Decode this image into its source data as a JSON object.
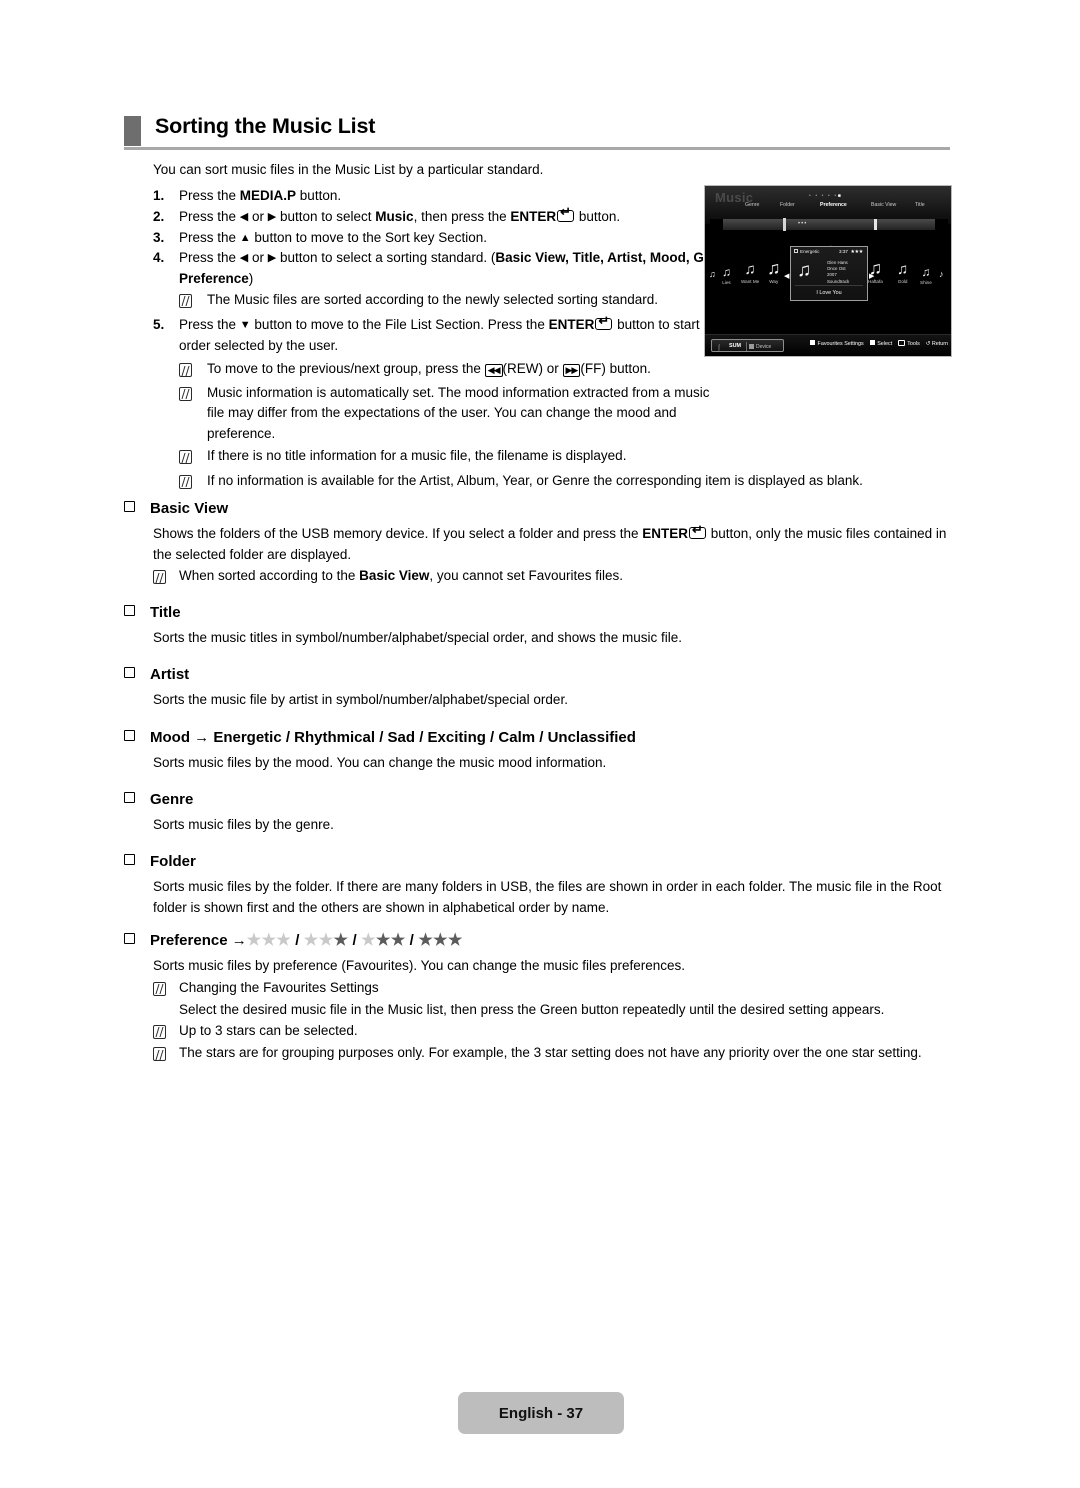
{
  "header": {
    "title": "Sorting the Music List"
  },
  "intro": "You can sort music files in the Music List by a particular standard.",
  "steps": [
    {
      "num": "1.",
      "parts": [
        {
          "t": "Press the ",
          "b": false
        },
        {
          "t": "MEDIA.P",
          "b": true
        },
        {
          "t": " button.",
          "b": false
        }
      ]
    },
    {
      "num": "2.",
      "parts": [
        {
          "t": "Press the ",
          "b": false
        },
        {
          "t": "◀",
          "b": false
        },
        {
          "t": " or ",
          "b": false
        },
        {
          "t": "▶",
          "b": false
        },
        {
          "t": " button to select ",
          "b": false
        },
        {
          "t": "Music",
          "b": true
        },
        {
          "t": ", then press the ",
          "b": false
        },
        {
          "t": "ENTER",
          "b": true
        },
        {
          "t": "ENTER_ICON",
          "b": false
        },
        {
          "t": " button.",
          "b": false
        }
      ]
    },
    {
      "num": "3.",
      "parts": [
        {
          "t": "Press the ",
          "b": false
        },
        {
          "t": "▲",
          "b": false
        },
        {
          "t": " button to move to the Sort key Section.",
          "b": false
        }
      ]
    },
    {
      "num": "4.",
      "parts": [
        {
          "t": "Press the ",
          "b": false
        },
        {
          "t": "◀",
          "b": false
        },
        {
          "t": " or ",
          "b": false
        },
        {
          "t": "▶",
          "b": false
        },
        {
          "t": " button to select a sorting standard. (",
          "b": false
        },
        {
          "t": "Basic View, Title, Artist, Mood, Genre, Folder, Preference",
          "b": true
        },
        {
          "t": ")",
          "b": false
        }
      ]
    },
    {
      "num": "5.",
      "parts": [
        {
          "t": "Press the ",
          "b": false
        },
        {
          "t": "▼",
          "b": false
        },
        {
          "t": " button to move to the File List Section.  Press the ",
          "b": false
        },
        {
          "t": "ENTER",
          "b": true
        },
        {
          "t": "ENTER_ICON",
          "b": false
        },
        {
          "t": " button to start playing music in the order selected by the user.",
          "b": false
        }
      ]
    }
  ],
  "note_step4": "The Music files are sorted according to the newly selected sorting standard.",
  "notes_step5": [
    "To move to the previous/next group, press the ◀◀ (REW) or ▶▶ (FF) button.",
    "Music information is automatically set. The mood information extracted from a music file may differ from the expectations of the user. You can change the mood and preference.",
    "If there is no title information for a music file, the filename is displayed.",
    "If no information is available for the Artist, Album, Year, or Genre the corresponding item is displayed as blank."
  ],
  "note_rew_label": "(REW)",
  "note_ff_label": "(FF)",
  "sections": {
    "basic_view": {
      "heading": "Basic View",
      "para_a": "Shows the folders of the USB memory device. If you select a folder and press the ",
      "para_enter": "ENTER",
      "para_b": " button, only the music files contained in the selected folder are displayed.",
      "note_a": "When sorted according to the ",
      "note_bold": "Basic View",
      "note_b": ", you cannot set Favourites files."
    },
    "title": {
      "heading": "Title",
      "para": "Sorts the music titles in symbol/number/alphabet/special order, and shows the music file."
    },
    "artist": {
      "heading": "Artist",
      "para": "Sorts the music file by artist in symbol/number/alphabet/special order."
    },
    "mood": {
      "heading": "Mood → Energetic / Rhythmical / Sad / Exciting / Calm / Unclassified",
      "para": "Sorts music files by the mood. You can change the music mood information."
    },
    "genre": {
      "heading": "Genre",
      "para": "Sorts music files by the genre."
    },
    "folder": {
      "heading": "Folder",
      "para": "Sorts music files by the folder. If there are many folders in USB, the files are shown in order in each folder. The music file in the Root folder is shown first and the others are shown in alphabetical order by name."
    },
    "preference": {
      "heading": "Preference →",
      "star_groups": [
        [
          0,
          0,
          0
        ],
        [
          0,
          0,
          1
        ],
        [
          0,
          1,
          1
        ],
        [
          1,
          1,
          1
        ]
      ],
      "para": "Sorts music files by preference (Favourites). You can change the music files preferences.",
      "notes": [
        "Changing the Favourites Settings",
        "Select the desired music file in the Music list, then press the Green button repeatedly until the desired setting appears.",
        "Up to 3 stars can be selected.",
        "The stars are for grouping purposes only. For example, the 3 star setting does not have any priority over the one star setting."
      ]
    }
  },
  "tv": {
    "title": "Music",
    "sort_options": [
      "Genre",
      "Folder",
      "Preference",
      "Basic View",
      "Title"
    ],
    "selected_sort": "Preference",
    "page_dots": "• • • • •",
    "page_dot_active": "■",
    "progress_dots": "•••",
    "carousel": [
      {
        "label": "Lies"
      },
      {
        "label": "Want Me"
      },
      {
        "label": "Way"
      },
      {
        "label": "Haftafa"
      },
      {
        "label": "Gold"
      },
      {
        "label": "Shine"
      }
    ],
    "popup": {
      "mood": "Energetic",
      "duration": "3:37",
      "stars": "★★★",
      "meta_lines": [
        "Glen Hans",
        "Once Ost",
        "2007",
        "Soundtrack"
      ],
      "song": "I Love You"
    },
    "bottom": {
      "device_name": "SUM",
      "device_label": "Device",
      "actions": [
        "Favourites Settings",
        "Select",
        "Tools",
        "Return"
      ]
    }
  },
  "footer": {
    "page_label": "English - 37"
  },
  "colors": {
    "header_accent": "#6e6e6e",
    "header_rule": "#a8a8a8",
    "footer_bg": "#bdbdbd",
    "star_on": "#5c5c5c",
    "star_off": "#c9c9c9"
  }
}
